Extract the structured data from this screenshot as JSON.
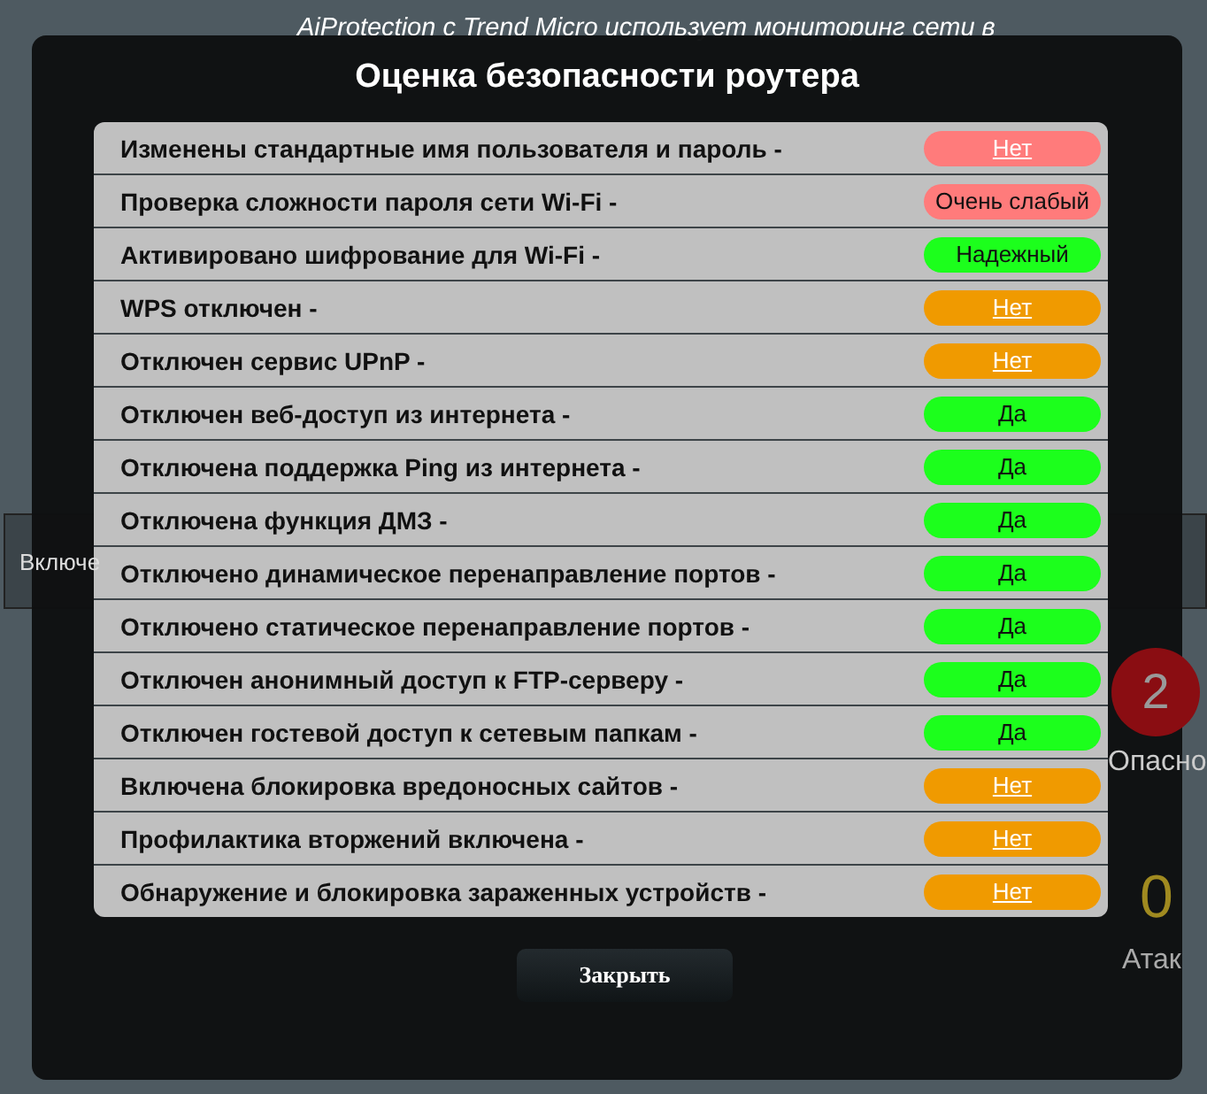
{
  "background": {
    "intro": "AiProtection с Trend Micro использует мониторинг сети в",
    "toggle_label": "Включе",
    "threat_count": "2",
    "threat_label": "Опасно",
    "attack_count": "0",
    "attack_label": "Атак"
  },
  "dialog": {
    "title": "Оценка безопасности роутера",
    "items": [
      {
        "label": "Изменены стандартные имя пользователя и пароль -",
        "status": "Нет",
        "kind": "bad",
        "link": true
      },
      {
        "label": "Проверка сложности пароля сети Wi-Fi -",
        "status": "Очень слабый",
        "kind": "bad",
        "link": false
      },
      {
        "label": "Активировано шифрование для Wi-Fi -",
        "status": "Надежный",
        "kind": "good",
        "link": false
      },
      {
        "label": "WPS отключен -",
        "status": "Нет",
        "kind": "warn",
        "link": true
      },
      {
        "label": "Отключен сервис UPnP -",
        "status": "Нет",
        "kind": "warn",
        "link": true
      },
      {
        "label": "Отключен веб-доступ из интернета -",
        "status": "Да",
        "kind": "good",
        "link": false
      },
      {
        "label": "Отключена поддержка Ping из интернета -",
        "status": "Да",
        "kind": "good",
        "link": false
      },
      {
        "label": "Отключена функция ДМЗ -",
        "status": "Да",
        "kind": "good",
        "link": false
      },
      {
        "label": "Отключено динамическое перенаправление портов -",
        "status": "Да",
        "kind": "good",
        "link": false
      },
      {
        "label": "Отключено статическое перенаправление портов -",
        "status": "Да",
        "kind": "good",
        "link": false
      },
      {
        "label": "Отключен анонимный доступ к FTP-серверу -",
        "status": "Да",
        "kind": "good",
        "link": false
      },
      {
        "label": "Отключен гостевой доступ к сетевым папкам -",
        "status": "Да",
        "kind": "good",
        "link": false
      },
      {
        "label": "Включена блокировка вредоносных сайтов -",
        "status": "Нет",
        "kind": "warn",
        "link": true
      },
      {
        "label": "Профилактика вторжений включена -",
        "status": "Нет",
        "kind": "warn",
        "link": true
      },
      {
        "label": "Обнаружение и блокировка зараженных устройств -",
        "status": "Нет",
        "kind": "warn",
        "link": true
      }
    ],
    "close_button": "Закрыть"
  }
}
